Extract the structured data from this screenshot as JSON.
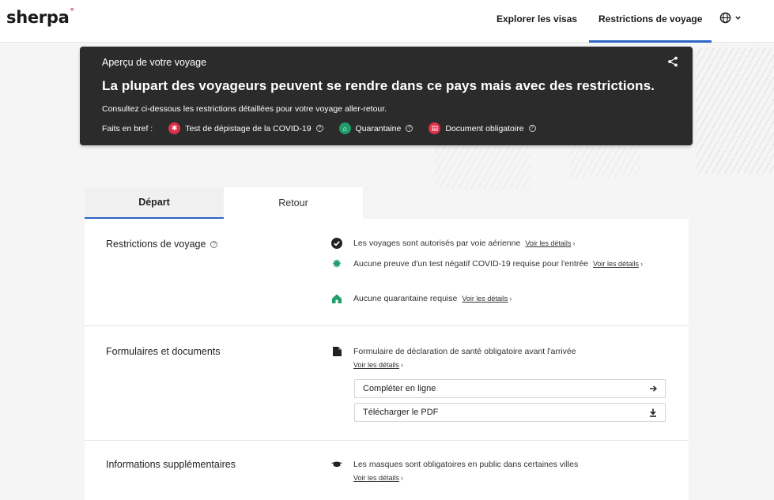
{
  "header": {
    "logo": "sherpa",
    "logo_mark": "°",
    "nav": [
      "Explorer les visas",
      "Restrictions de voyage"
    ],
    "language_icon": "globe-icon"
  },
  "banner": {
    "subtitle": "Aperçu de votre voyage",
    "headline": "La plupart des voyageurs peuvent se rendre dans ce pays mais avec des restrictions.",
    "description": "Consultez ci-dessous les restrictions détaillées pour votre voyage aller-retour.",
    "facts_label": "Faits en bref :",
    "facts": [
      {
        "label": "Test de dépistage de la COVID-19",
        "icon": "covid-test-icon",
        "color": "#e0314b"
      },
      {
        "label": "Quarantaine",
        "icon": "quarantine-icon",
        "color": "#1f9d6a"
      },
      {
        "label": "Document obligatoire",
        "icon": "document-icon",
        "color": "#e0314b"
      }
    ]
  },
  "tabs": [
    {
      "label": "Départ",
      "active": true
    },
    {
      "label": "Retour",
      "active": false
    }
  ],
  "sections": {
    "travel": {
      "title": "Restrictions de voyage",
      "items": [
        {
          "text": "Les voyages sont autorisés par voie aérienne",
          "link": "Voir les détails"
        },
        {
          "text": "Aucune preuve d'un test négatif COVID-19 requise pour l'entrée",
          "link": "Voir les détails"
        },
        {
          "text": "Aucune quarantaine requise",
          "link": "Voir les détails"
        }
      ]
    },
    "forms": {
      "title": "Formulaires et documents",
      "item": {
        "text": "Formulaire de déclaration de santé obligatoire avant l'arrivée",
        "link": "Voir les détails"
      },
      "buttons": [
        {
          "label": "Compléter en ligne",
          "icon": "arrow-right-icon"
        },
        {
          "label": "Télécharger le PDF",
          "icon": "download-icon"
        }
      ]
    },
    "extra": {
      "title": "Informations supplémentaires",
      "item": {
        "text": "Les masques sont obligatoires en public dans certaines villes",
        "link": "Voir les détails"
      }
    }
  },
  "colors": {
    "accent": "#2d67c6",
    "banner_bg": "#2b2b2c",
    "danger": "#e0314b",
    "success": "#1f9d6a"
  }
}
